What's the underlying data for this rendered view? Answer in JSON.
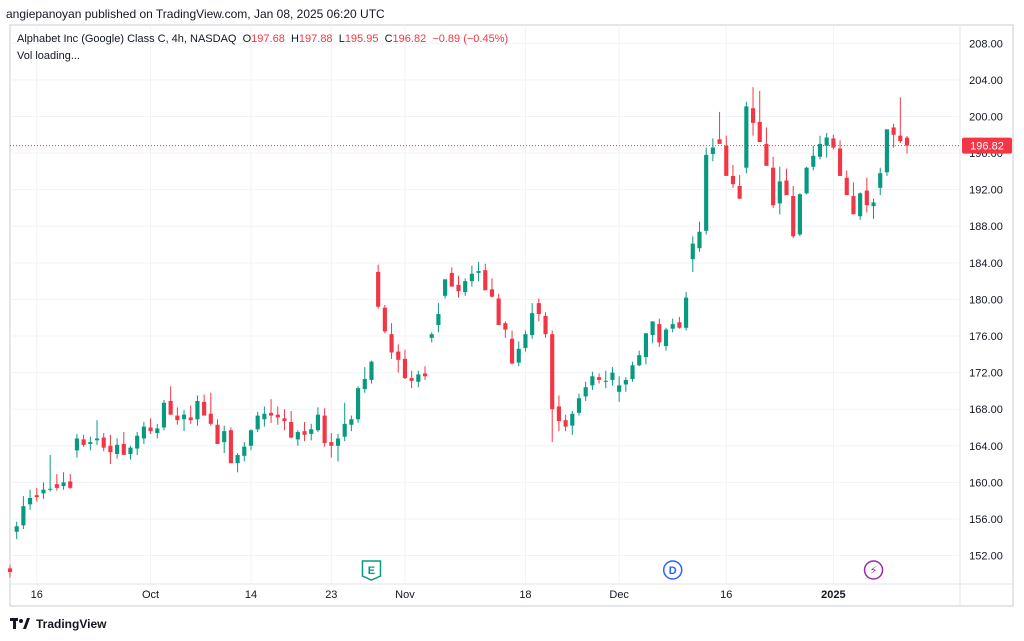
{
  "header": {
    "publisher_line": "angiepanoyan published on TradingView.com, Jan 08, 2025 06:20 UTC"
  },
  "legend": {
    "symbol": "Alphabet Inc (Google) Class C, 4h, NASDAQ",
    "o_label": "O",
    "o_value": "197.68",
    "h_label": "H",
    "h_value": "197.88",
    "l_label": "L",
    "l_value": "195.95",
    "c_label": "C",
    "c_value": "196.82",
    "change": "−0.89 (−0.45%)",
    "vol": "Vol loading..."
  },
  "footer": {
    "brand": "TradingView"
  },
  "colors": {
    "up": "#089981",
    "down": "#f23645",
    "grid": "#f0f3fa",
    "axis_text": "#131722",
    "last_price": "#f23645"
  },
  "chart_data": {
    "type": "candlestick",
    "ylim": [
      149,
      210
    ],
    "y_ticks": [
      "152.00",
      "156.00",
      "160.00",
      "164.00",
      "168.00",
      "172.00",
      "176.00",
      "180.00",
      "184.00",
      "188.00",
      "192.00",
      "196.00",
      "200.00",
      "204.00",
      "208.00"
    ],
    "x_ticks": [
      {
        "label": "16",
        "index": 4,
        "bold": false
      },
      {
        "label": "Oct",
        "index": 21,
        "bold": false
      },
      {
        "label": "14",
        "index": 36,
        "bold": false
      },
      {
        "label": "23",
        "index": 48,
        "bold": false
      },
      {
        "label": "Nov",
        "index": 59,
        "bold": false
      },
      {
        "label": "18",
        "index": 77,
        "bold": false
      },
      {
        "label": "Dec",
        "index": 91,
        "bold": false
      },
      {
        "label": "16",
        "index": 107,
        "bold": false
      },
      {
        "label": "2025",
        "index": 123,
        "bold": true
      }
    ],
    "last_price": 196.82,
    "last_price_label": "196.82",
    "events": [
      {
        "label": "E",
        "index": 54,
        "kind": "earnings"
      },
      {
        "label": "D",
        "index": 99,
        "kind": "dividend"
      },
      {
        "label": "⚡",
        "index": 129,
        "kind": "split"
      }
    ],
    "candles": [
      [
        150.6,
        151.0,
        149.6,
        150.2
      ],
      [
        154.6,
        155.7,
        153.8,
        155.2
      ],
      [
        155.3,
        158.5,
        154.9,
        157.4
      ],
      [
        157.6,
        159.2,
        157.0,
        158.3
      ],
      [
        158.6,
        159.4,
        157.9,
        158.4
      ],
      [
        158.8,
        160.0,
        158.2,
        159.2
      ],
      [
        159.3,
        163.0,
        159.0,
        159.3
      ],
      [
        159.8,
        160.9,
        159.1,
        159.4
      ],
      [
        159.6,
        161.1,
        159.2,
        160.0
      ],
      [
        160.1,
        160.9,
        159.3,
        159.4
      ],
      [
        163.5,
        165.3,
        162.7,
        164.8
      ],
      [
        164.7,
        165.2,
        163.9,
        164.1
      ],
      [
        164.2,
        165.0,
        163.5,
        164.4
      ],
      [
        164.6,
        166.8,
        164.1,
        164.8
      ],
      [
        164.9,
        165.4,
        163.4,
        163.8
      ],
      [
        164.0,
        165.2,
        162.0,
        163.3
      ],
      [
        163.1,
        164.8,
        162.6,
        164.1
      ],
      [
        164.2,
        165.5,
        163.2,
        163.0
      ],
      [
        163.1,
        164.0,
        162.5,
        163.8
      ],
      [
        163.7,
        165.5,
        163.0,
        165.1
      ],
      [
        164.8,
        166.6,
        164.2,
        166.1
      ],
      [
        166.0,
        167.0,
        165.3,
        165.6
      ],
      [
        165.4,
        166.4,
        164.8,
        165.9
      ],
      [
        166.0,
        169.0,
        165.7,
        168.7
      ],
      [
        168.9,
        170.5,
        167.4,
        167.4
      ],
      [
        167.3,
        168.2,
        166.3,
        166.8
      ],
      [
        166.9,
        167.9,
        165.6,
        167.4
      ],
      [
        167.1,
        168.4,
        166.4,
        166.8
      ],
      [
        166.9,
        169.5,
        166.2,
        168.9
      ],
      [
        168.8,
        169.6,
        167.5,
        167.3
      ],
      [
        167.5,
        169.8,
        166.2,
        166.4
      ],
      [
        166.3,
        166.9,
        164.4,
        164.2
      ],
      [
        164.4,
        166.2,
        163.2,
        165.6
      ],
      [
        165.7,
        166.0,
        162.1,
        162.1
      ],
      [
        162.1,
        163.2,
        161.1,
        163.0
      ],
      [
        162.9,
        164.4,
        162.3,
        163.9
      ],
      [
        164.0,
        165.8,
        163.5,
        165.7
      ],
      [
        165.8,
        167.7,
        165.5,
        167.3
      ],
      [
        166.9,
        168.3,
        166.1,
        167.5
      ],
      [
        167.6,
        169.1,
        166.5,
        167.3
      ],
      [
        167.4,
        168.3,
        166.3,
        167.1
      ],
      [
        167.0,
        168.0,
        165.7,
        166.7
      ],
      [
        166.6,
        167.8,
        164.8,
        164.9
      ],
      [
        164.7,
        165.7,
        164.0,
        165.5
      ],
      [
        165.6,
        166.6,
        164.5,
        165.2
      ],
      [
        165.3,
        166.4,
        164.6,
        165.8
      ],
      [
        165.7,
        168.2,
        165.5,
        167.4
      ],
      [
        167.3,
        168.1,
        163.9,
        164.3
      ],
      [
        164.4,
        165.4,
        162.7,
        164.0
      ],
      [
        164.0,
        165.3,
        162.3,
        164.8
      ],
      [
        165.0,
        168.7,
        164.5,
        166.4
      ],
      [
        166.3,
        167.3,
        165.6,
        166.9
      ],
      [
        166.9,
        170.5,
        166.5,
        170.3
      ],
      [
        170.2,
        172.6,
        169.8,
        171.3
      ],
      [
        171.2,
        173.3,
        170.8,
        173.2
      ],
      [
        183.0,
        183.8,
        179.0,
        179.2
      ],
      [
        179.1,
        179.4,
        176.3,
        176.5
      ],
      [
        176.2,
        177.4,
        173.5,
        174.2
      ],
      [
        174.3,
        175.1,
        172.0,
        173.4
      ],
      [
        173.5,
        174.5,
        171.3,
        171.4
      ],
      [
        171.4,
        172.2,
        170.3,
        171.1
      ],
      [
        171.0,
        172.2,
        170.4,
        171.8
      ],
      [
        171.9,
        172.7,
        171.2,
        171.6
      ],
      [
        175.8,
        176.4,
        175.3,
        176.2
      ],
      [
        177.2,
        179.6,
        176.4,
        178.4
      ],
      [
        180.4,
        181.6,
        180.1,
        182.2
      ],
      [
        182.9,
        183.5,
        181.6,
        181.4
      ],
      [
        181.6,
        182.6,
        180.2,
        180.9
      ],
      [
        180.8,
        182.3,
        180.4,
        182.0
      ],
      [
        182.0,
        183.7,
        181.4,
        182.8
      ],
      [
        182.9,
        184.1,
        182.0,
        183.1
      ],
      [
        183.2,
        183.9,
        181.6,
        181.0
      ],
      [
        181.1,
        182.3,
        180.2,
        180.3
      ],
      [
        180.1,
        180.6,
        178.0,
        177.2
      ],
      [
        177.4,
        177.6,
        175.8,
        176.7
      ],
      [
        175.7,
        176.6,
        172.9,
        173.0
      ],
      [
        173.1,
        175.4,
        172.7,
        174.6
      ],
      [
        174.7,
        176.6,
        174.3,
        176.2
      ],
      [
        176.1,
        179.6,
        175.7,
        178.5
      ],
      [
        179.6,
        180.1,
        177.6,
        178.4
      ],
      [
        178.2,
        178.6,
        175.8,
        176.2
      ],
      [
        176.2,
        176.6,
        164.4,
        168.0
      ],
      [
        168.3,
        169.5,
        165.6,
        166.7
      ],
      [
        166.8,
        167.4,
        165.6,
        166.1
      ],
      [
        166.2,
        167.8,
        165.2,
        167.5
      ],
      [
        167.6,
        169.7,
        167.3,
        169.2
      ],
      [
        169.4,
        171.0,
        168.9,
        170.4
      ],
      [
        170.6,
        172.1,
        170.1,
        171.6
      ],
      [
        171.5,
        171.9,
        170.8,
        171.2
      ],
      [
        171.0,
        172.2,
        170.3,
        171.1
      ],
      [
        171.2,
        172.6,
        170.6,
        172.0
      ],
      [
        169.9,
        171.6,
        168.8,
        170.6
      ],
      [
        170.7,
        171.5,
        169.9,
        171.2
      ],
      [
        171.3,
        173.2,
        171.0,
        172.8
      ],
      [
        172.8,
        174.4,
        172.7,
        173.9
      ],
      [
        173.7,
        176.3,
        172.9,
        176.3
      ],
      [
        176.1,
        177.6,
        175.2,
        177.6
      ],
      [
        177.3,
        177.9,
        174.8,
        175.3
      ],
      [
        174.9,
        176.9,
        174.4,
        176.7
      ],
      [
        176.8,
        177.9,
        176.4,
        177.3
      ],
      [
        177.5,
        178.1,
        176.8,
        176.9
      ],
      [
        176.9,
        180.8,
        176.6,
        180.2
      ],
      [
        184.4,
        186.9,
        183.0,
        186.1
      ],
      [
        185.6,
        188.5,
        185.2,
        187.4
      ],
      [
        187.5,
        196.6,
        187.1,
        195.8
      ],
      [
        195.9,
        197.6,
        195.1,
        196.6
      ],
      [
        197.5,
        200.5,
        197.4,
        197.0
      ],
      [
        196.8,
        197.9,
        193.8,
        193.5
      ],
      [
        193.5,
        194.7,
        192.2,
        192.6
      ],
      [
        192.4,
        193.6,
        191.4,
        191.0
      ],
      [
        194.4,
        201.6,
        193.8,
        201.1
      ],
      [
        200.9,
        203.2,
        197.9,
        199.3
      ],
      [
        199.4,
        202.8,
        198.6,
        197.2
      ],
      [
        197.0,
        198.8,
        194.8,
        194.6
      ],
      [
        194.4,
        195.6,
        190.0,
        190.3
      ],
      [
        190.5,
        194.5,
        189.3,
        192.9
      ],
      [
        193.0,
        194.3,
        192.4,
        191.4
      ],
      [
        191.3,
        192.4,
        186.7,
        186.9
      ],
      [
        187.1,
        191.6,
        186.9,
        191.5
      ],
      [
        191.6,
        194.5,
        191.5,
        194.4
      ],
      [
        194.5,
        196.8,
        194.1,
        195.7
      ],
      [
        195.6,
        197.9,
        195.3,
        197.0
      ],
      [
        196.8,
        198.2,
        195.5,
        197.7
      ],
      [
        197.6,
        198.0,
        196.4,
        196.6
      ],
      [
        196.5,
        197.4,
        194.6,
        193.5
      ],
      [
        193.3,
        194.1,
        191.6,
        191.4
      ],
      [
        191.3,
        192.8,
        189.5,
        189.3
      ],
      [
        189.1,
        191.7,
        188.7,
        191.6
      ],
      [
        191.9,
        193.3,
        189.5,
        190.3
      ],
      [
        190.2,
        191.0,
        188.8,
        190.6
      ],
      [
        192.2,
        194.4,
        191.4,
        193.8
      ],
      [
        193.9,
        196.5,
        193.5,
        198.6
      ],
      [
        198.8,
        199.2,
        196.6,
        198.0
      ],
      [
        197.9,
        202.1,
        197.1,
        197.3
      ],
      [
        197.68,
        197.88,
        195.95,
        196.82
      ]
    ]
  }
}
